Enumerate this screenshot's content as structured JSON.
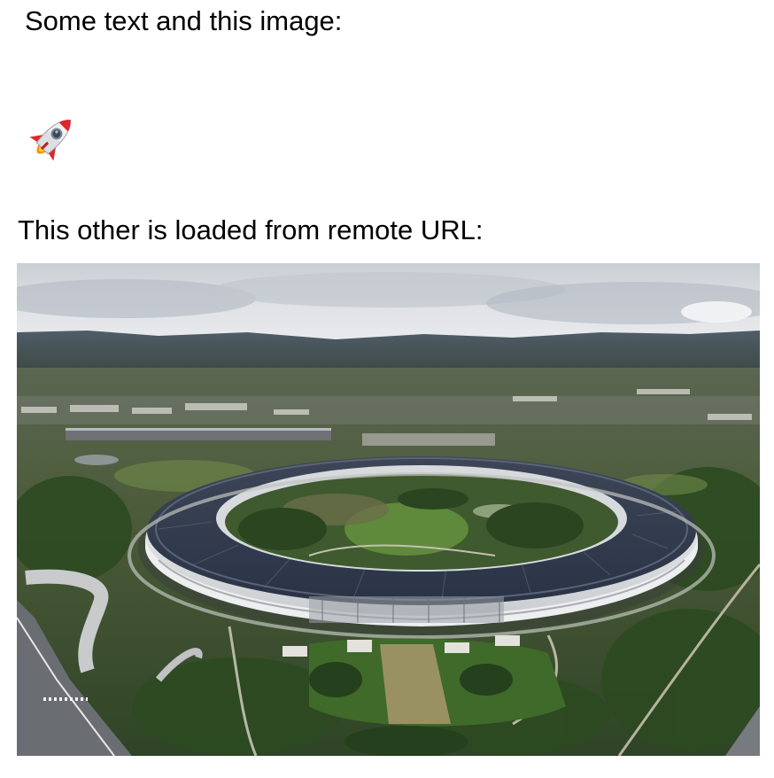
{
  "intro_text": "Some text and this image:",
  "inline_image": {
    "icon": "rocket-icon"
  },
  "remote_caption": "This other is loaded from remote URL:",
  "remote_image": {
    "subject": "aerial-campus-ring-building"
  }
}
